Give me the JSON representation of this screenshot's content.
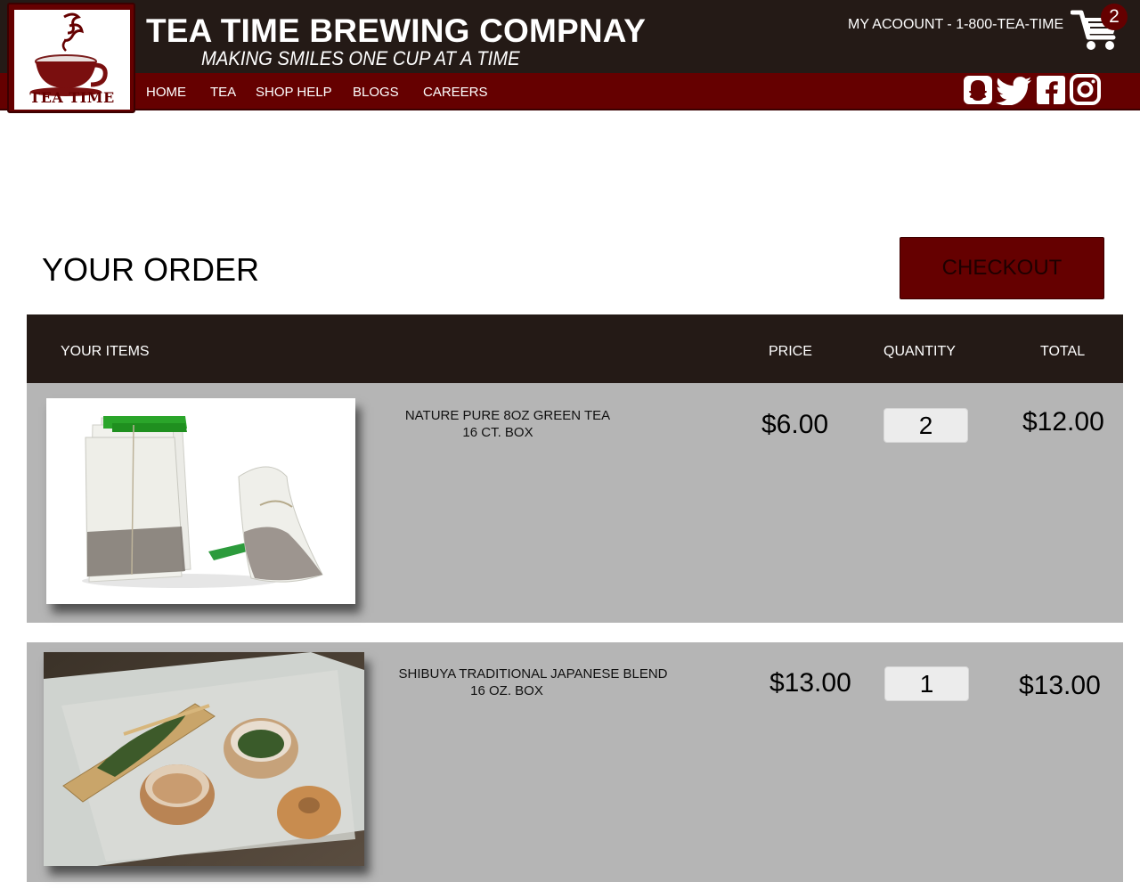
{
  "brand": {
    "logo_text": "TEA TIME",
    "title": "TEA TIME BREWING COMPNAY",
    "tagline": "MAKING SMILES ONE CUP AT A TIME"
  },
  "account_text": "MY ACOOUNT - 1-800-TEA-TIME",
  "cart": {
    "count": "2"
  },
  "nav": [
    "HOME",
    "TEA",
    "SHOP HELP",
    "BLOGS",
    "CAREERS"
  ],
  "social_icons": [
    "snapchat-icon",
    "twitter-icon",
    "facebook-icon",
    "instagram-icon"
  ],
  "order": {
    "title": "YOUR ORDER",
    "checkout_label": "CHECKOUT"
  },
  "table": {
    "headers": {
      "items": "YOUR ITEMS",
      "price": "PRICE",
      "quantity": "QUANTITY",
      "total": "TOTAL"
    },
    "rows": [
      {
        "name_line1": "NATURE PURE 8OZ GREEN TEA",
        "name_line2": "16 CT. BOX",
        "price": "$6.00",
        "quantity": "2",
        "total": "$12.00"
      },
      {
        "name_line1": "SHIBUYA TRADITIONAL JAPANESE BLEND",
        "name_line2": "16 OZ. BOX",
        "price": "$13.00",
        "quantity": "1",
        "total": "$13.00"
      }
    ]
  },
  "colors": {
    "dark_brown": "#241a16",
    "maroon": "#650000",
    "row_gray": "#b5b5b5"
  }
}
